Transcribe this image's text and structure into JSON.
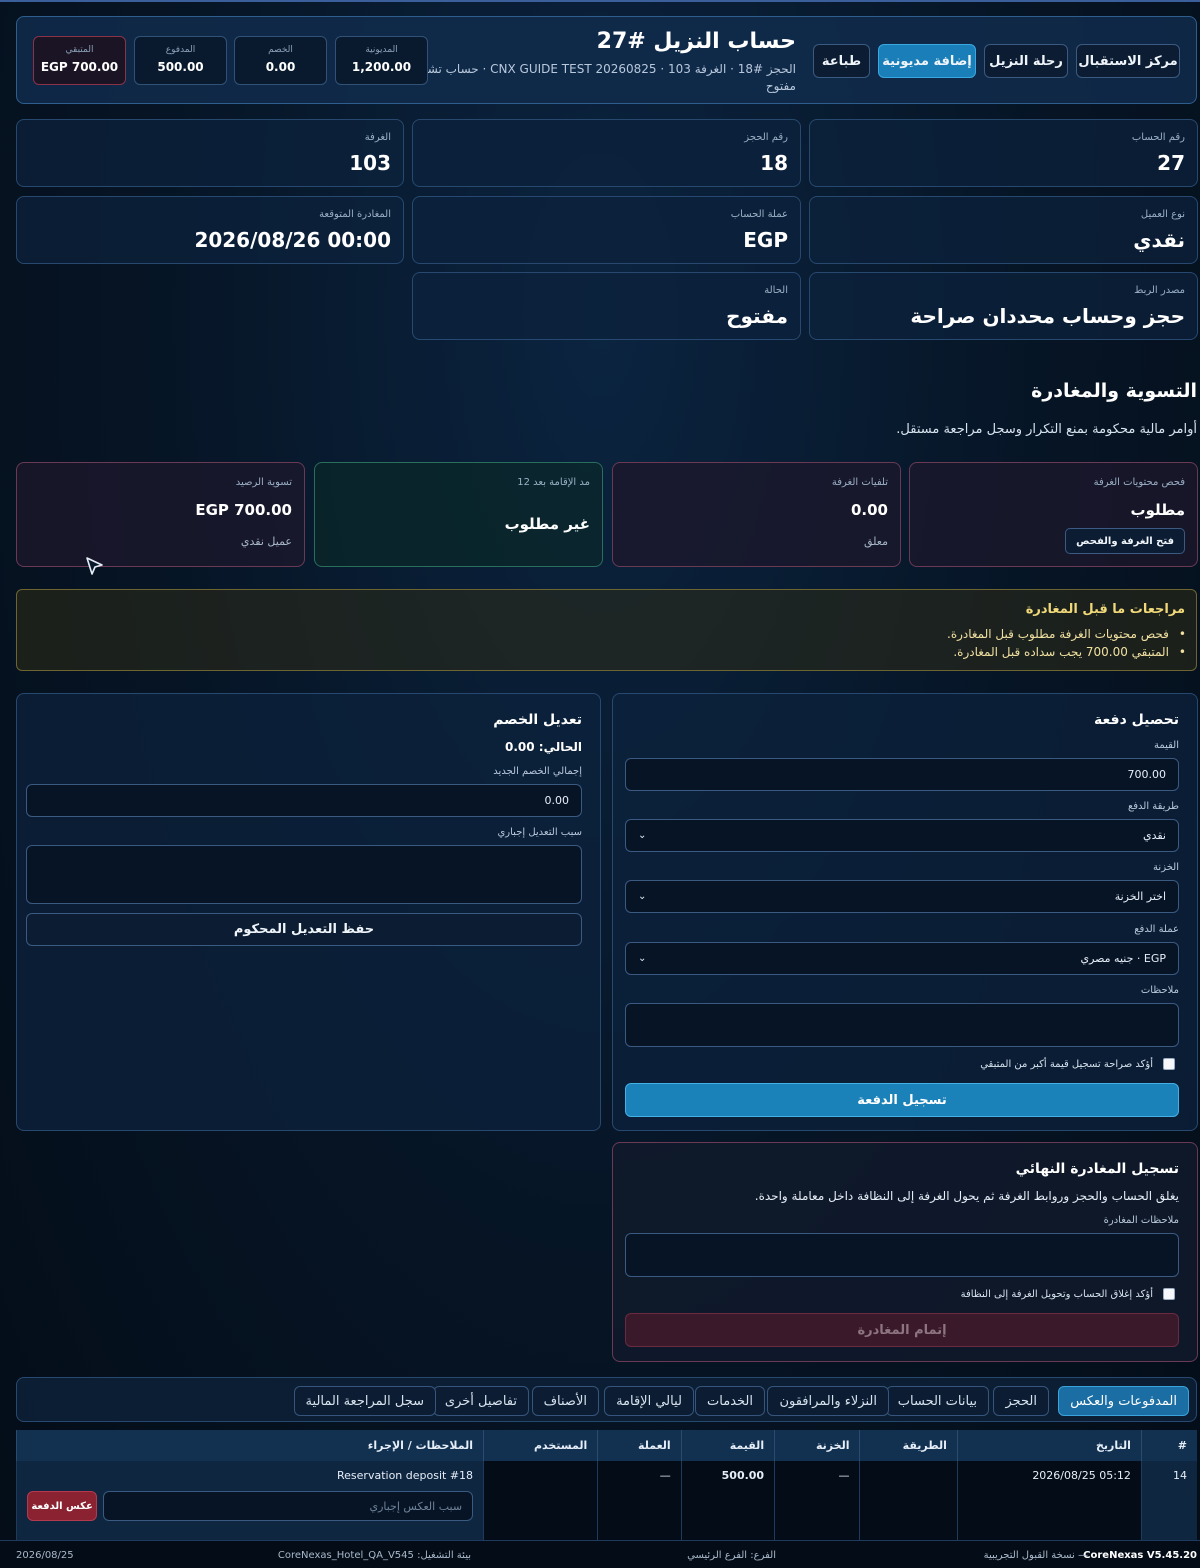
{
  "header": {
    "buttons": [
      "مركز الاستقبال",
      "رحلة النزيل",
      "إضافة مديونية",
      "طباعة"
    ],
    "title": "حساب النزيل #27",
    "subtitle": "الحجز #18 · الغرفة 103 · CNX GUIDE TEST 20260825 · حساب تشغيلي",
    "status": "مفتوح",
    "stats": [
      {
        "label": "المديونية",
        "value": "1,200.00"
      },
      {
        "label": "الخصم",
        "value": "0.00"
      },
      {
        "label": "المدفوع",
        "value": "500.00"
      },
      {
        "label": "المتبقي",
        "value": "EGP 700.00"
      }
    ]
  },
  "info": {
    "account_no": {
      "label": "رقم الحساب",
      "value": "27"
    },
    "reservation_no": {
      "label": "رقم الحجز",
      "value": "18"
    },
    "room": {
      "label": "الغرفة",
      "value": "103"
    },
    "client_type": {
      "label": "نوع العميل",
      "value": "نقدي"
    },
    "currency": {
      "label": "عملة الحساب",
      "value": "EGP"
    },
    "departure": {
      "label": "المغادرة المتوقعة",
      "value": "2026/08/26 00:00"
    },
    "link_source": {
      "label": "مصدر الربط",
      "value": "حجز وحساب محددان صراحة"
    },
    "state": {
      "label": "الحالة",
      "value": "مفتوح"
    }
  },
  "settlement": {
    "title": "التسوية والمغادرة",
    "description": "أوامر مالية محكومة بمنع التكرار وسجل مراجعة مستقل.",
    "cards": [
      {
        "label": "فحص محتويات الغرفة",
        "value": "مطلوب",
        "button": "فتح الغرفة والفحص"
      },
      {
        "label": "تلفيات الغرفة",
        "value": "0.00",
        "sub": "معلق"
      },
      {
        "label": "مد الإقامة بعد 12",
        "value": "غير مطلوب"
      },
      {
        "label": "تسوية الرصيد",
        "value": "EGP 700.00",
        "sub": "عميل نقدي"
      }
    ]
  },
  "warnings": {
    "title": "مراجعات ما قبل المغادرة",
    "items": [
      "فحص محتويات الغرفة مطلوب قبل المغادرة.",
      "المتبقي 700.00 يجب سداده قبل المغادرة."
    ]
  },
  "payment": {
    "title": "تحصيل دفعة",
    "amount_label": "القيمة",
    "amount_value": "700.00",
    "method_label": "طريقة الدفع",
    "method_value": "نقدي",
    "safe_label": "الخزنة",
    "safe_value": "اختر الخزنة",
    "currency_label": "عملة الدفع",
    "currency_value": "EGP · جنيه مصري",
    "notes_label": "ملاحظات",
    "confirm_label": "أؤكد صراحة تسجيل قيمة أكبر من المتبقي",
    "submit": "تسجيل الدفعة"
  },
  "discount": {
    "title": "تعديل الخصم",
    "current": "الحالي: 0.00",
    "new_total_label": "إجمالي الخصم الجديد",
    "new_total_value": "0.00",
    "reason_label": "سبب التعديل إجباري",
    "submit": "حفظ التعديل المحكوم"
  },
  "checkout": {
    "title": "تسجيل المغادرة النهائي",
    "description": "يغلق الحساب والحجز وروابط الغرفة ثم يحول الغرفة إلى النظافة داخل معاملة واحدة.",
    "notes_label": "ملاحظات المغادرة",
    "confirm_label": "أؤكد إغلاق الحساب وتحويل الغرفة إلى النظافة",
    "submit": "إتمام المغادرة"
  },
  "tabs": [
    "المدفوعات والعكس",
    "الحجز",
    "بيانات الحساب",
    "النزلاء والمرافقون",
    "الخدمات",
    "ليالي الإقامة",
    "الأصناف",
    "تفاصيل أخرى",
    "سجل المراجعة المالية"
  ],
  "table": {
    "headers": [
      "#",
      "التاريخ",
      "الطريقة",
      "الخزنة",
      "القيمة",
      "العملة",
      "المستخدم",
      "الملاحظات / الإجراء"
    ],
    "rows": [
      {
        "id": "14",
        "date": "2026/08/25 05:12",
        "method": "",
        "safe": "—",
        "amount": "500.00",
        "currency": "—",
        "user": "",
        "note": "Reservation deposit #18",
        "reason_placeholder": "سبب العكس إجباري",
        "reverse_button": "عكس الدفعة"
      }
    ]
  },
  "footer": {
    "version": "CoreNexas V5.45.20",
    "edition": "— نسخة القبول التجريبية",
    "branch": "الفرع: الفرع الرئيسي",
    "env": "بيئة التشغيل: CoreNexas_Hotel_QA_V545",
    "date": "2026/08/25"
  },
  "colors": {
    "accent": "#1a7fb8",
    "danger": "#8a2232",
    "warning_text": "#f1d97a"
  }
}
